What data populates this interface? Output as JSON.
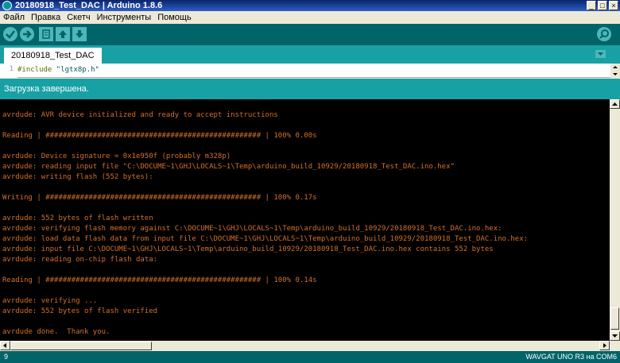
{
  "window": {
    "title": "20180918_Test_DAC | Arduino 1.8.6",
    "minimize": "_",
    "maximize": "□",
    "close": "×"
  },
  "menu": [
    "Файл",
    "Правка",
    "Скетч",
    "Инструменты",
    "Помощь"
  ],
  "toolbar": {
    "buttons": [
      "verify-icon",
      "upload-icon",
      "new-icon",
      "open-icon",
      "save-icon"
    ],
    "serial_monitor": "search-icon",
    "accent": "#006468",
    "button_color": "#4db7bb"
  },
  "tabs": [
    {
      "label": "20180918_Test_DAC"
    }
  ],
  "editor": {
    "line_number": "1",
    "keyword": "#include",
    "value": " \"lgtx8p.h\""
  },
  "status": {
    "text": "Загрузка завершена."
  },
  "console": {
    "text_color": "#d4702a",
    "lines": [
      "avrdude: AVR device initialized and ready to accept instructions",
      "",
      "Reading | ################################################## | 100% 0.00s",
      "",
      "avrdude: Device signature = 0x1e950f (probably m328p)",
      "avrdude: reading input file \"C:\\DOCUME~1\\GHJ\\LOCALS~1\\Temp\\arduino_build_10929/20180918_Test_DAC.ino.hex\"",
      "avrdude: writing flash (552 bytes):",
      "",
      "Writing | ################################################## | 100% 0.17s",
      "",
      "avrdude: 552 bytes of flash written",
      "avrdude: verifying flash memory against C:\\DOCUME~1\\GHJ\\LOCALS~1\\Temp\\arduino_build_10929/20180918_Test_DAC.ino.hex:",
      "avrdude: load data flash data from input file C:\\DOCUME~1\\GHJ\\LOCALS~1\\Temp\\arduino_build_10929/20180918_Test_DAC.ino.hex:",
      "avrdude: input file C:\\DOCUME~1\\GHJ\\LOCALS~1\\Temp\\arduino_build_10929/20180918_Test_DAC.ino.hex contains 552 bytes",
      "avrdude: reading on-chip flash data:",
      "",
      "Reading | ################################################## | 100% 0.14s",
      "",
      "avrdude: verifying ...",
      "avrdude: 552 bytes of flash verified",
      "",
      "avrdude done.  Thank you."
    ]
  },
  "footer": {
    "line": "9",
    "board": "WAVGAT UNO R3 на COM6"
  }
}
